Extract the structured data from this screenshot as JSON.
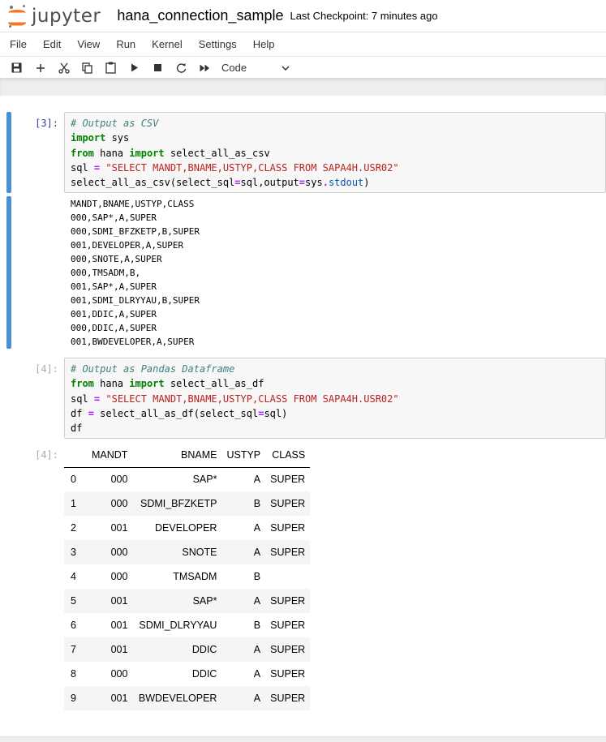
{
  "header": {
    "logo_text": "jupyter",
    "notebook_name": "hana_connection_sample",
    "checkpoint": "Last Checkpoint: 7 minutes ago"
  },
  "menu": [
    "File",
    "Edit",
    "View",
    "Run",
    "Kernel",
    "Settings",
    "Help"
  ],
  "toolbar": {
    "cell_type": "Code",
    "icons": [
      "save-icon",
      "plus-icon",
      "cut-icon",
      "copy-icon",
      "paste-icon",
      "run-icon",
      "stop-icon",
      "restart-icon",
      "fast-forward-icon"
    ]
  },
  "cells": [
    {
      "prompt": "[3]:",
      "lines": [
        "# Output as CSV",
        "import sys",
        "from hana import select_all_as_csv",
        "sql = \"SELECT MANDT,BNAME,USTYP,CLASS FROM SAPA4H.USR02\"",
        "select_all_as_csv(select_sql=sql,output=sys.stdout)"
      ],
      "output": "MANDT,BNAME,USTYP,CLASS\n000,SAP*,A,SUPER\n000,SDMI_BFZKETP,B,SUPER\n001,DEVELOPER,A,SUPER\n000,SNOTE,A,SUPER\n000,TMSADM,B,\n001,SAP*,A,SUPER\n001,SDMI_DLRYYAU,B,SUPER\n001,DDIC,A,SUPER\n000,DDIC,A,SUPER\n001,BWDEVELOPER,A,SUPER"
    },
    {
      "prompt": "[4]:",
      "lines": [
        "# Output as Pandas Dataframe",
        "from hana import select_all_as_df",
        "sql = \"SELECT MANDT,BNAME,USTYP,CLASS FROM SAPA4H.USR02\"",
        "df = select_all_as_df(select_sql=sql)",
        "df"
      ],
      "out_prompt": "[4]:"
    }
  ],
  "dataframe": {
    "columns": [
      "MANDT",
      "BNAME",
      "USTYP",
      "CLASS"
    ],
    "rows": [
      [
        "0",
        "000",
        "SAP*",
        "A",
        "SUPER"
      ],
      [
        "1",
        "000",
        "SDMI_BFZKETP",
        "B",
        "SUPER"
      ],
      [
        "2",
        "001",
        "DEVELOPER",
        "A",
        "SUPER"
      ],
      [
        "3",
        "000",
        "SNOTE",
        "A",
        "SUPER"
      ],
      [
        "4",
        "000",
        "TMSADM",
        "B",
        ""
      ],
      [
        "5",
        "001",
        "SAP*",
        "A",
        "SUPER"
      ],
      [
        "6",
        "001",
        "SDMI_DLRYYAU",
        "B",
        "SUPER"
      ],
      [
        "7",
        "001",
        "DDIC",
        "A",
        "SUPER"
      ],
      [
        "8",
        "000",
        "DDIC",
        "A",
        "SUPER"
      ],
      [
        "9",
        "001",
        "BWDEVELOPER",
        "A",
        "SUPER"
      ]
    ]
  }
}
